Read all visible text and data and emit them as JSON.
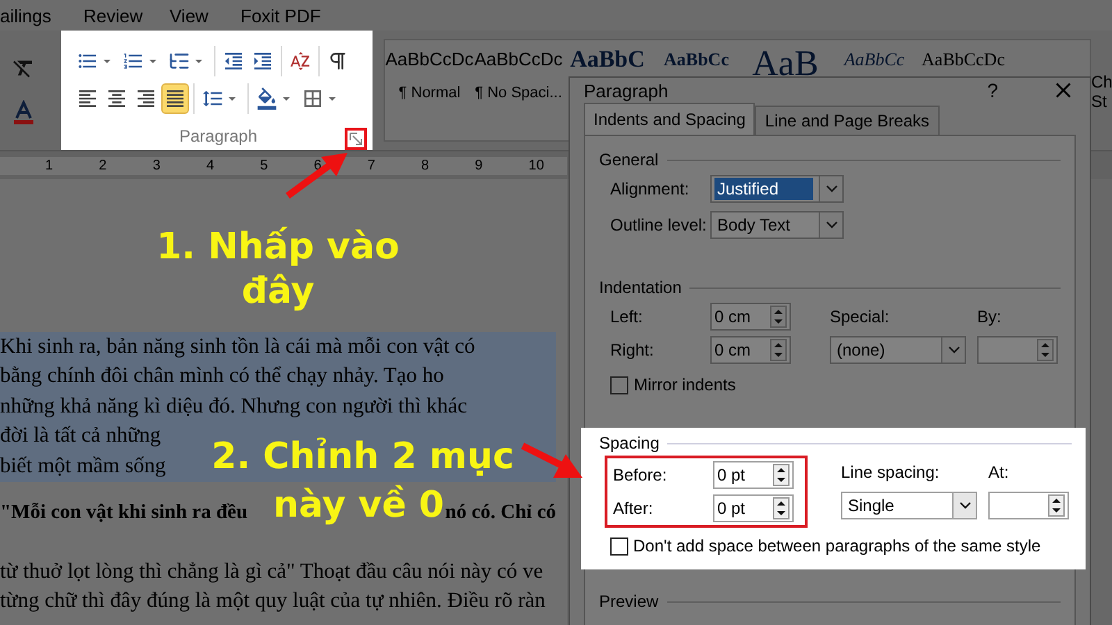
{
  "menu_tabs": [
    {
      "label": "ailings"
    },
    {
      "label": "Review"
    },
    {
      "label": "View"
    },
    {
      "label": "Foxit PDF"
    }
  ],
  "paragraph_group": {
    "label": "Paragraph",
    "rows": [
      [
        [
          {
            "kind": "bullets",
            "dropdown": true,
            "selected": false
          },
          {
            "kind": "numbering",
            "dropdown": true,
            "selected": false
          },
          {
            "kind": "multilevel",
            "dropdown": true,
            "selected": false
          }
        ],
        [
          {
            "kind": "decrease_indent",
            "dropdown": false,
            "selected": false
          },
          {
            "kind": "increase_indent",
            "dropdown": false,
            "selected": false
          }
        ],
        [
          {
            "kind": "sort",
            "dropdown": false,
            "selected": false
          }
        ],
        [
          {
            "kind": "pilcrow",
            "dropdown": false,
            "selected": false
          }
        ]
      ],
      [
        [
          {
            "kind": "align_left",
            "dropdown": false,
            "selected": false
          },
          {
            "kind": "align_center",
            "dropdown": false,
            "selected": false
          },
          {
            "kind": "align_right",
            "dropdown": false,
            "selected": false
          },
          {
            "kind": "justify",
            "dropdown": false,
            "selected": true
          }
        ],
        [
          {
            "kind": "line_spacing",
            "dropdown": true,
            "selected": false
          }
        ],
        [
          {
            "kind": "shading",
            "dropdown": true,
            "selected": false
          },
          {
            "kind": "borders",
            "dropdown": true,
            "selected": false
          }
        ]
      ]
    ]
  },
  "styles": [
    {
      "sample": "AaBbCcDc",
      "name": "¶ Normal",
      "kind": "normal"
    },
    {
      "sample": "AaBbCcDc",
      "name": "¶ No Spaci...",
      "kind": "normal"
    },
    {
      "sample": "AaBbC",
      "kind": "heading1"
    },
    {
      "sample": "AaBbCc",
      "kind": "heading2"
    },
    {
      "sample": "AaB",
      "kind": "title"
    },
    {
      "sample": "AaBbCc",
      "kind": "subtitle"
    },
    {
      "sample": "AaBbCcDc",
      "kind": "emphasis"
    }
  ],
  "change_styles": {
    "label_lines": [
      "Ch",
      "St"
    ]
  },
  "ruler": [
    "1",
    "2",
    "3",
    "4",
    "5",
    "6",
    "7",
    "8",
    "9",
    "10"
  ],
  "document": [
    {
      "text": "Khi sinh ra, bản năng sinh tồn là cái mà mỗi con vật có",
      "highlighted": true,
      "bold": false
    },
    {
      "text": "bằng chính đôi chân mình có thể chạy nhảy. Tạo ho",
      "highlighted": true,
      "bold": false
    },
    {
      "text": "những khả năng kì diệu đó. Nhưng con người thì khác",
      "highlighted": true,
      "bold": false
    },
    {
      "text": "đời là tất cả những",
      "highlighted": true,
      "bold": false
    },
    {
      "text": "biết một mầm sống",
      "highlighted": true,
      "bold": false
    },
    {
      "text": "\"Mỗi con vật khi sinh ra đều",
      "trailing": "nó có. Chỉ có",
      "highlighted": false,
      "bold": true
    },
    {
      "text": "từ thuở lọt lòng thì chẳng là gì cả\" Thoạt đầu câu nói này có ve",
      "highlighted": false,
      "bold": false
    },
    {
      "text": "từng chữ thì đây đúng là một quy luật của tự nhiên. Điều rõ ràn",
      "highlighted": false,
      "bold": false
    }
  ],
  "dialog": {
    "title": "Paragraph",
    "help": "?",
    "tabs": [
      {
        "label": "Indents and Spacing",
        "selected": true
      },
      {
        "label": "Line and Page Breaks",
        "selected": false
      }
    ],
    "general": {
      "heading": "General",
      "alignment": {
        "label": "Alignment:",
        "value": "Justified",
        "focused": true
      },
      "outline_level": {
        "label": "Outline level:",
        "value": "Body Text",
        "focused": false
      }
    },
    "indentation": {
      "heading": "Indentation",
      "left": {
        "label": "Left:",
        "value": "0 cm"
      },
      "right": {
        "label": "Right:",
        "value": "0 cm"
      },
      "special": {
        "label": "Special:",
        "value": "(none)"
      },
      "by": {
        "label": "By:"
      },
      "mirror_indents": {
        "label": "Mirror indents",
        "checked": false
      }
    },
    "spacing": {
      "heading": "Spacing",
      "before": {
        "label": "Before:",
        "value": "0 pt"
      },
      "after": {
        "label": "After:",
        "value": "0 pt"
      },
      "line_spacing": {
        "label": "Line spacing:",
        "value": "Single"
      },
      "at": {
        "label": "At:"
      },
      "dont_add_space": {
        "label": "Don't add space between paragraphs of the same style",
        "checked": false
      }
    },
    "preview": {
      "heading": "Preview"
    }
  },
  "annotations": [
    {
      "text": "1. Nhấp vào đây"
    },
    {
      "text": "2. Chỉnh 2 mục"
    },
    {
      "text": "này về 0"
    }
  ]
}
